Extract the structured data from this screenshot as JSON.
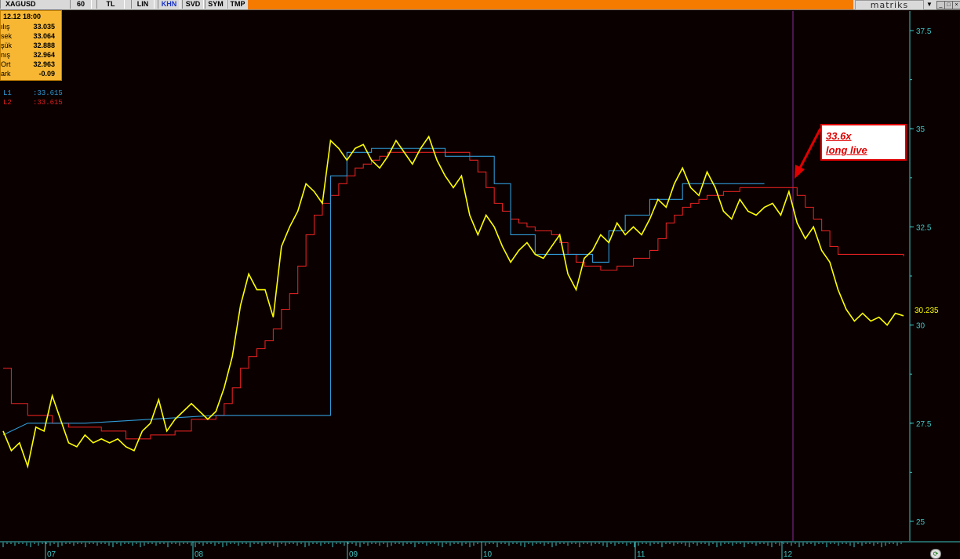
{
  "toolbar": {
    "symbol": "XAGUSD",
    "buttons": [
      {
        "label": "60",
        "active": false
      },
      {
        "label": "TL",
        "active": false
      },
      {
        "label": "LIN",
        "active": false
      },
      {
        "label": "KHN",
        "active": true
      },
      {
        "label": "SVD",
        "active": false
      },
      {
        "label": "SYM",
        "active": false
      },
      {
        "label": "TMP",
        "active": false
      }
    ],
    "brand": "matriks",
    "menu_arrow": "▼"
  },
  "info": {
    "date": "12.12 18:00",
    "rows": [
      {
        "label": "ılış",
        "value": "33.035"
      },
      {
        "label": "sek",
        "value": "33.064"
      },
      {
        "label": "şük",
        "value": "32.888"
      },
      {
        "label": "nış",
        "value": "32.964"
      },
      {
        "label": "Ort",
        "value": "32.963"
      },
      {
        "label": "ark",
        "value": "-0.09"
      }
    ]
  },
  "legend": [
    {
      "name": "L1",
      "value": ":33.615",
      "color": "#2f9ad6"
    },
    {
      "name": "L2",
      "value": ":33.615",
      "color": "#e02020"
    }
  ],
  "annotation": {
    "line1": "33.6x",
    "line2": "long live"
  },
  "chart_data": {
    "type": "line",
    "y_ticks": [
      "37.5",
      "35",
      "32.5",
      "30",
      "27.5",
      "25"
    ],
    "ylim": [
      24.5,
      38.0
    ],
    "x_ticks": [
      "07",
      "08",
      "09",
      "10",
      "11",
      "12"
    ],
    "last_price_label": "30.235",
    "series": [
      {
        "key": "price",
        "color": "#ffff00",
        "values": [
          [
            0,
            27.3
          ],
          [
            1,
            26.8
          ],
          [
            2,
            27.0
          ],
          [
            3,
            26.4
          ],
          [
            4,
            27.4
          ],
          [
            5,
            27.3
          ],
          [
            6,
            28.2
          ],
          [
            7,
            27.6
          ],
          [
            8,
            27.0
          ],
          [
            9,
            26.9
          ],
          [
            10,
            27.2
          ],
          [
            11,
            27.0
          ],
          [
            12,
            27.1
          ],
          [
            13,
            27.0
          ],
          [
            14,
            27.1
          ],
          [
            15,
            26.9
          ],
          [
            16,
            26.8
          ],
          [
            17,
            27.3
          ],
          [
            18,
            27.5
          ],
          [
            19,
            28.1
          ],
          [
            20,
            27.3
          ],
          [
            21,
            27.6
          ],
          [
            22,
            27.8
          ],
          [
            23,
            28.0
          ],
          [
            24,
            27.8
          ],
          [
            25,
            27.6
          ],
          [
            26,
            27.8
          ],
          [
            27,
            28.4
          ],
          [
            28,
            29.2
          ],
          [
            29,
            30.5
          ],
          [
            30,
            31.3
          ],
          [
            31,
            30.9
          ],
          [
            32,
            30.9
          ],
          [
            33,
            30.2
          ],
          [
            34,
            32.0
          ],
          [
            35,
            32.5
          ],
          [
            36,
            32.9
          ],
          [
            37,
            33.6
          ],
          [
            38,
            33.4
          ],
          [
            39,
            33.1
          ],
          [
            40,
            34.7
          ],
          [
            41,
            34.5
          ],
          [
            42,
            34.2
          ],
          [
            43,
            34.5
          ],
          [
            44,
            34.6
          ],
          [
            45,
            34.2
          ],
          [
            46,
            34.0
          ],
          [
            47,
            34.3
          ],
          [
            48,
            34.7
          ],
          [
            49,
            34.4
          ],
          [
            50,
            34.1
          ],
          [
            51,
            34.5
          ],
          [
            52,
            34.8
          ],
          [
            53,
            34.2
          ],
          [
            54,
            33.8
          ],
          [
            55,
            33.5
          ],
          [
            56,
            33.8
          ],
          [
            57,
            32.8
          ],
          [
            58,
            32.3
          ],
          [
            59,
            32.8
          ],
          [
            60,
            32.5
          ],
          [
            61,
            32.0
          ],
          [
            62,
            31.6
          ],
          [
            63,
            31.9
          ],
          [
            64,
            32.1
          ],
          [
            65,
            31.8
          ],
          [
            66,
            31.7
          ],
          [
            67,
            32.0
          ],
          [
            68,
            32.3
          ],
          [
            69,
            31.3
          ],
          [
            70,
            30.9
          ],
          [
            71,
            31.7
          ],
          [
            72,
            31.9
          ],
          [
            73,
            32.3
          ],
          [
            74,
            32.1
          ],
          [
            75,
            32.6
          ],
          [
            76,
            32.3
          ],
          [
            77,
            32.5
          ],
          [
            78,
            32.3
          ],
          [
            79,
            32.7
          ],
          [
            80,
            33.2
          ],
          [
            81,
            33.0
          ],
          [
            82,
            33.6
          ],
          [
            83,
            34.0
          ],
          [
            84,
            33.5
          ],
          [
            85,
            33.3
          ],
          [
            86,
            33.9
          ],
          [
            87,
            33.5
          ],
          [
            88,
            32.9
          ],
          [
            89,
            32.7
          ],
          [
            90,
            33.2
          ],
          [
            91,
            32.9
          ],
          [
            92,
            32.8
          ],
          [
            93,
            33.0
          ],
          [
            94,
            33.1
          ],
          [
            95,
            32.8
          ],
          [
            96,
            33.4
          ],
          [
            97,
            32.6
          ],
          [
            98,
            32.2
          ],
          [
            99,
            32.5
          ],
          [
            100,
            31.9
          ],
          [
            101,
            31.6
          ],
          [
            102,
            30.9
          ],
          [
            103,
            30.4
          ],
          [
            104,
            30.1
          ],
          [
            105,
            30.3
          ],
          [
            106,
            30.1
          ],
          [
            107,
            30.2
          ],
          [
            108,
            30.0
          ],
          [
            109,
            30.3
          ],
          [
            110,
            30.235
          ]
        ]
      },
      {
        "key": "L2",
        "color": "#e02020",
        "values": [
          [
            0,
            28.9
          ],
          [
            1,
            28.0
          ],
          [
            3,
            27.7
          ],
          [
            6,
            27.5
          ],
          [
            8,
            27.4
          ],
          [
            12,
            27.3
          ],
          [
            15,
            27.1
          ],
          [
            18,
            27.2
          ],
          [
            21,
            27.3
          ],
          [
            23,
            27.6
          ],
          [
            26,
            27.7
          ],
          [
            27,
            28.0
          ],
          [
            28,
            28.4
          ],
          [
            29,
            28.9
          ],
          [
            30,
            29.2
          ],
          [
            31,
            29.4
          ],
          [
            32,
            29.6
          ],
          [
            33,
            29.9
          ],
          [
            34,
            30.4
          ],
          [
            35,
            30.8
          ],
          [
            36,
            31.5
          ],
          [
            37,
            32.3
          ],
          [
            38,
            32.8
          ],
          [
            39,
            33.1
          ],
          [
            40,
            33.3
          ],
          [
            41,
            33.6
          ],
          [
            42,
            33.8
          ],
          [
            43,
            34.0
          ],
          [
            44,
            34.1
          ],
          [
            45,
            34.2
          ],
          [
            46,
            34.3
          ],
          [
            47,
            34.4
          ],
          [
            48,
            34.4
          ],
          [
            49,
            34.4
          ],
          [
            52,
            34.4
          ],
          [
            54,
            34.4
          ],
          [
            56,
            34.4
          ],
          [
            57,
            34.2
          ],
          [
            58,
            33.9
          ],
          [
            59,
            33.5
          ],
          [
            60,
            33.1
          ],
          [
            61,
            32.9
          ],
          [
            62,
            32.7
          ],
          [
            63,
            32.6
          ],
          [
            64,
            32.5
          ],
          [
            65,
            32.4
          ],
          [
            67,
            32.3
          ],
          [
            68,
            32.1
          ],
          [
            69,
            31.8
          ],
          [
            70,
            31.6
          ],
          [
            71,
            31.5
          ],
          [
            73,
            31.4
          ],
          [
            75,
            31.5
          ],
          [
            77,
            31.7
          ],
          [
            79,
            31.9
          ],
          [
            80,
            32.2
          ],
          [
            81,
            32.6
          ],
          [
            82,
            32.8
          ],
          [
            83,
            33.0
          ],
          [
            84,
            33.1
          ],
          [
            85,
            33.2
          ],
          [
            86,
            33.3
          ],
          [
            88,
            33.4
          ],
          [
            90,
            33.5
          ],
          [
            93,
            33.5
          ],
          [
            96,
            33.5
          ],
          [
            97,
            33.3
          ],
          [
            98,
            33.0
          ],
          [
            99,
            32.7
          ],
          [
            100,
            32.4
          ],
          [
            101,
            32.0
          ],
          [
            102,
            31.8
          ],
          [
            104,
            31.8
          ],
          [
            110,
            31.75
          ]
        ]
      },
      {
        "key": "L1",
        "color": "#2f9ad6",
        "values": [
          [
            0,
            27.2
          ],
          [
            3,
            27.5
          ],
          [
            10,
            27.5
          ],
          [
            18,
            27.6
          ],
          [
            26,
            27.7
          ],
          [
            40,
            27.7
          ],
          [
            40,
            33.8
          ],
          [
            42,
            33.8
          ],
          [
            42,
            34.4
          ],
          [
            45,
            34.4
          ],
          [
            45,
            34.5
          ],
          [
            54,
            34.5
          ],
          [
            54,
            34.3
          ],
          [
            60,
            34.3
          ],
          [
            60,
            33.6
          ],
          [
            62,
            33.6
          ],
          [
            62,
            32.3
          ],
          [
            65,
            32.3
          ],
          [
            65,
            31.8
          ],
          [
            72,
            31.8
          ],
          [
            72,
            31.6
          ],
          [
            74,
            31.6
          ],
          [
            74,
            32.4
          ],
          [
            76,
            32.4
          ],
          [
            76,
            32.8
          ],
          [
            79,
            32.8
          ],
          [
            79,
            33.2
          ],
          [
            83,
            33.2
          ],
          [
            83,
            33.6
          ],
          [
            93,
            33.6
          ]
        ]
      }
    ]
  }
}
